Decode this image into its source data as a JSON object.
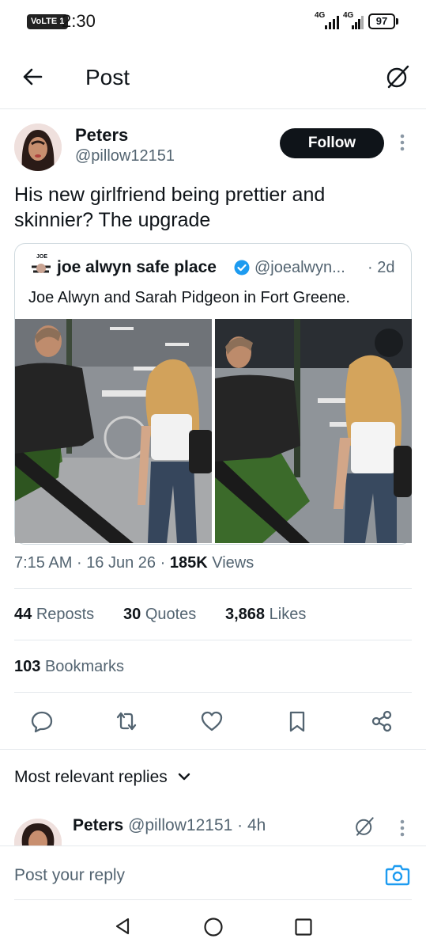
{
  "status_bar": {
    "volte": "VoLTE 1",
    "time": "2:30",
    "net1": "4G",
    "net2": "4G",
    "battery": "97"
  },
  "header": {
    "title": "Post"
  },
  "author": {
    "name": "Peters",
    "handle": "@pillow12151",
    "follow_label": "Follow"
  },
  "tweet": {
    "text": "His new girlfriend being prettier and skinnier? The upgrade"
  },
  "quote": {
    "avatar_text": "JOE",
    "name": "joe alwyn safe place",
    "handle": "@joealwyn...",
    "age": "· 2d",
    "text": "Joe Alwyn and Sarah Pidgeon in Fort Greene."
  },
  "meta": {
    "time": "7:15 AM",
    "sep1": "·",
    "date": "16 Jun 26",
    "sep2": "·",
    "views_count": "185K",
    "views_label": "Views"
  },
  "stats": {
    "reposts_count": "44",
    "reposts_label": "Reposts",
    "quotes_count": "30",
    "quotes_label": "Quotes",
    "likes_count": "3,868",
    "likes_label": "Likes",
    "bookmarks_count": "103",
    "bookmarks_label": "Bookmarks"
  },
  "actions": {
    "icons": [
      "reply-icon",
      "repost-icon",
      "like-icon",
      "bookmark-icon",
      "share-icon"
    ]
  },
  "replies": {
    "section_title": "Most relevant replies",
    "first_reply": {
      "name": "Peters",
      "handle": "@pillow12151",
      "age": "· 4h"
    }
  },
  "composer": {
    "placeholder": "Post your reply"
  },
  "colors": {
    "text": "#0f1419",
    "muted": "#536471",
    "accent": "#1d9bf0",
    "border": "#e5e9ec"
  }
}
